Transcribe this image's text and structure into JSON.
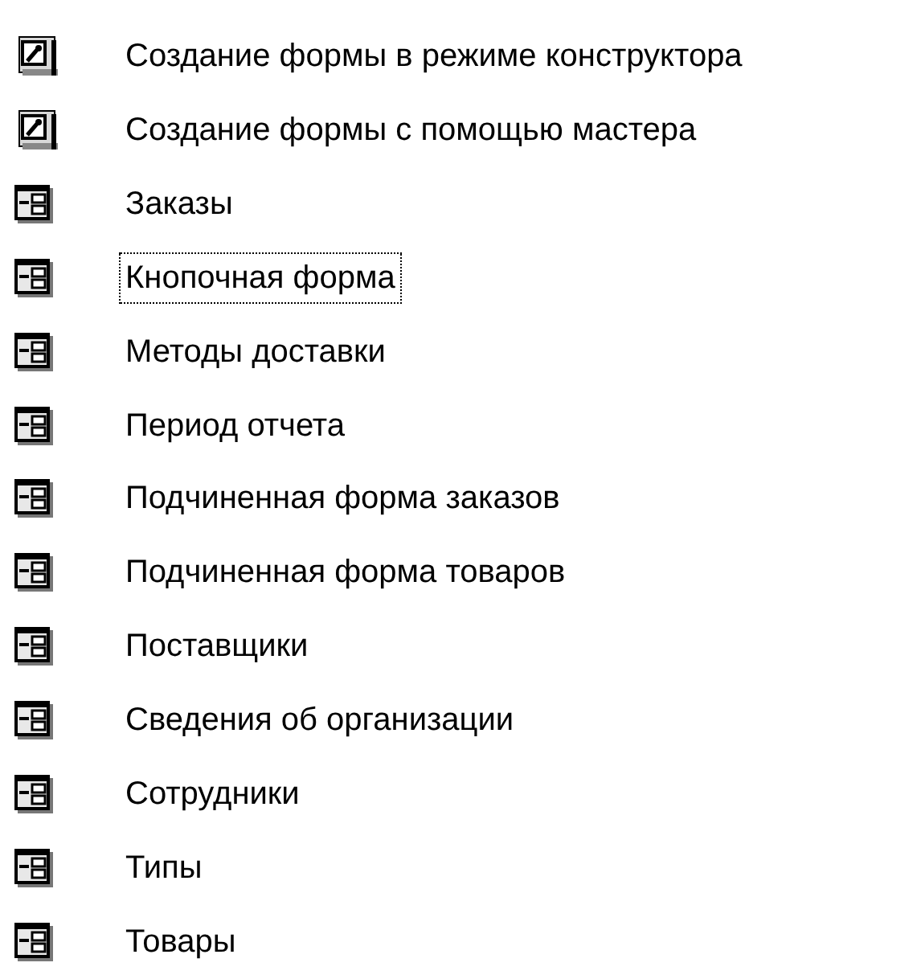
{
  "items": [
    {
      "kind": "shortcut",
      "label": "Создание формы в режиме конструктора",
      "focused": false
    },
    {
      "kind": "shortcut",
      "label": "Создание формы с помощью мастера",
      "focused": false
    },
    {
      "kind": "form",
      "label": "Заказы",
      "focused": false
    },
    {
      "kind": "form",
      "label": "Кнопочная форма",
      "focused": true
    },
    {
      "kind": "form",
      "label": "Методы доставки",
      "focused": false
    },
    {
      "kind": "form",
      "label": "Период отчета",
      "focused": false
    },
    {
      "kind": "form",
      "label": "Подчиненная форма заказов",
      "focused": false
    },
    {
      "kind": "form",
      "label": "Подчиненная форма товаров",
      "focused": false
    },
    {
      "kind": "form",
      "label": "Поставщики",
      "focused": false
    },
    {
      "kind": "form",
      "label": "Сведения об организации",
      "focused": false
    },
    {
      "kind": "form",
      "label": "Сотрудники",
      "focused": false
    },
    {
      "kind": "form",
      "label": "Типы",
      "focused": false
    },
    {
      "kind": "form",
      "label": "Товары",
      "focused": false
    }
  ]
}
